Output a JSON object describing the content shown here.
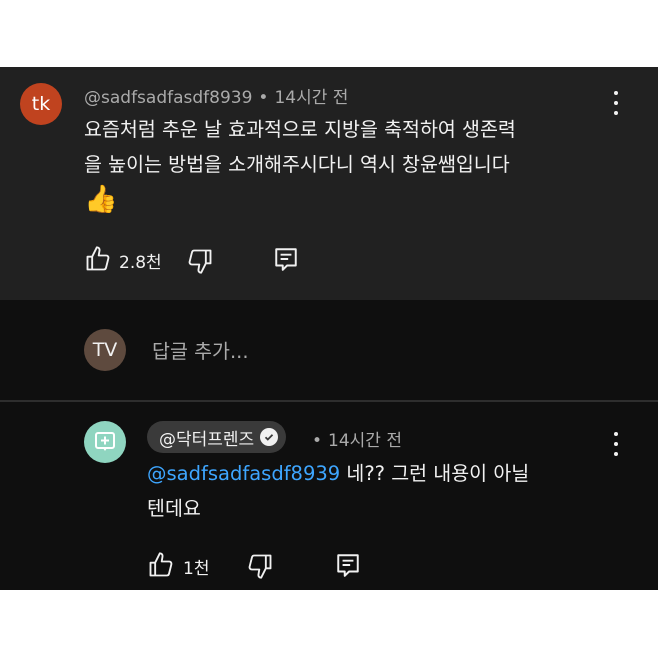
{
  "comment": {
    "avatar_initials": "tk",
    "author": "@sadfsadfasdf8939",
    "time": "14시간 전",
    "text_line1": "요즘처럼 추운 날 효과적으로 지방을 축적하여 생존력",
    "text_line2": "을 높이는 방법을 소개해주시다니 역시 창윤쌤입니다",
    "emoji": "👍",
    "likes": "2.8천"
  },
  "reply_box": {
    "avatar_initials": "TV",
    "placeholder": "답글 추가..."
  },
  "reply": {
    "author": "@닥터프렌즈",
    "time": "14시간 전",
    "mention": "@sadfsadfasdf8939",
    "text_line1_rest": " 네?? 그런 내용이 아닐",
    "text_line2": "텐데요",
    "likes": "1천"
  },
  "colors": {
    "panel_bg": "#0f0f0f",
    "comment_bg": "#212121",
    "mention": "#3ea6ff",
    "avatar_tk": "#c0431f",
    "avatar_doctor": "#8fd5c0"
  },
  "icons": [
    "thumbs-up-icon",
    "thumbs-down-icon",
    "reply-icon",
    "more-vert-icon",
    "verified-check-icon"
  ]
}
